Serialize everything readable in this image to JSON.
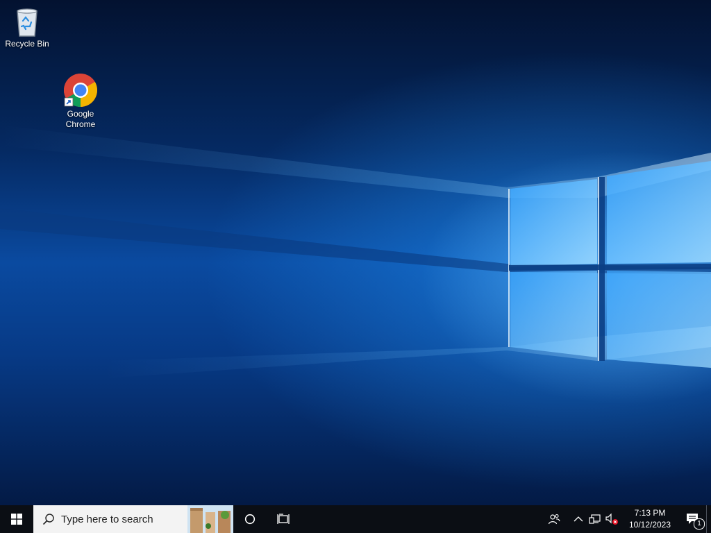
{
  "desktop": {
    "icons": [
      {
        "name": "recycle-bin",
        "label": "Recycle Bin",
        "icon": "recycle-bin-icon"
      },
      {
        "name": "google-chrome",
        "label": "Google\nChrome",
        "icon": "chrome-icon"
      }
    ]
  },
  "taskbar": {
    "start_icon": "windows-logo-icon",
    "search": {
      "placeholder": "Type here to search",
      "icon": "search-icon"
    },
    "cortana_icon": "cortana-circle-icon",
    "task_view_icon": "task-view-icon",
    "tray": {
      "people_icon": "people-icon",
      "show_hidden_icon": "chevron-up-icon",
      "network_icon": "network-icon",
      "volume_icon": "volume-muted-icon"
    },
    "clock": {
      "time": "7:13 PM",
      "date": "10/12/2023"
    },
    "action_center": {
      "icon": "notifications-icon",
      "badge": "1"
    }
  },
  "colors": {
    "taskbar_bg": "#0b0e14",
    "search_bg": "#f3f3f3",
    "wallpaper_accent": "#1e8cf0"
  }
}
